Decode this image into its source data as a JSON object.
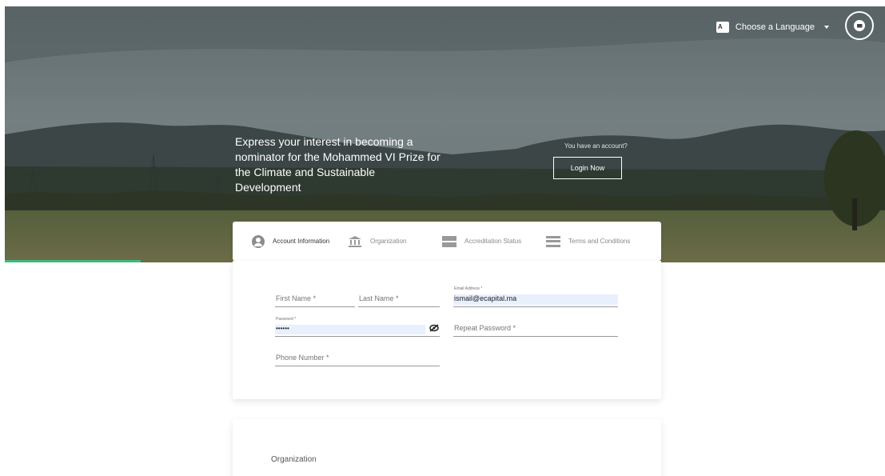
{
  "header": {
    "language_label": "Choose a Language",
    "language_icon": "translate-icon",
    "mail_icon": "mail-icon"
  },
  "hero": {
    "headline": "Express your interest in becoming a nominator for the Mohammed VI Prize for the Climate and Sustainable Development",
    "account_prompt": "You have an account?",
    "login_label": "Login Now"
  },
  "steps": [
    {
      "label": "Account Information",
      "icon": "user-circle-icon",
      "active": true
    },
    {
      "label": "Organization",
      "icon": "bank-icon",
      "active": false
    },
    {
      "label": "Accreditation Status",
      "icon": "server-icon",
      "active": false
    },
    {
      "label": "Terms and Conditions",
      "icon": "menu-icon",
      "active": false
    }
  ],
  "form": {
    "first_name": {
      "label": "First Name *",
      "value": ""
    },
    "last_name": {
      "label": "Last Name *",
      "value": ""
    },
    "email": {
      "label": "Email Address *",
      "value": "ismail@ecapital.ma"
    },
    "password": {
      "label": "Password *",
      "value": "••••••"
    },
    "repeat_password": {
      "label": "Repeat Password *",
      "value": ""
    },
    "phone": {
      "label": "Phone Number *",
      "value": ""
    }
  },
  "organization": {
    "title": "Organization"
  },
  "colors": {
    "accent": "#3fb87f",
    "autofill": "#e8f0fe"
  }
}
